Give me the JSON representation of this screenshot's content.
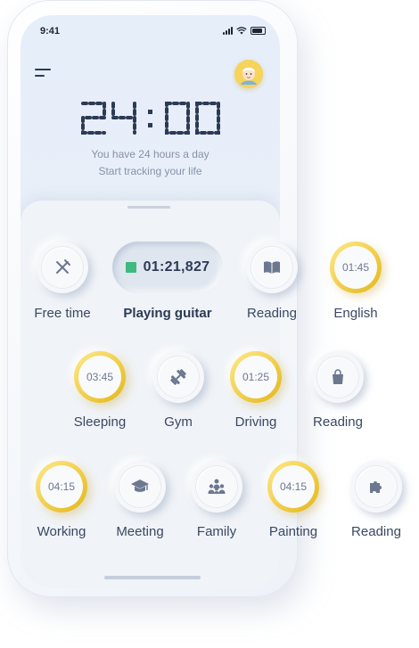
{
  "status": {
    "time": "9:41"
  },
  "clock": {
    "display": "24:00"
  },
  "header": {
    "line1": "You have 24 hours a day",
    "line2": "Start tracking your life"
  },
  "active": {
    "label": "Playing guitar",
    "timer": "01:21,827",
    "indicator_color": "#3fb97f"
  },
  "activities": {
    "free_time": {
      "label": "Free time",
      "icon": "fork-knife-icon"
    },
    "reading1": {
      "label": "Reading",
      "icon": "book-icon"
    },
    "english": {
      "label": "English",
      "timer": "01:45"
    },
    "sleeping": {
      "label": "Sleeping",
      "timer": "03:45"
    },
    "gym": {
      "label": "Gym",
      "icon": "dumbbell-icon"
    },
    "driving": {
      "label": "Driving",
      "timer": "01:25"
    },
    "reading2": {
      "label": "Reading",
      "icon": "shopping-bag-icon"
    },
    "working": {
      "label": "Working",
      "timer": "04:15"
    },
    "meeting": {
      "label": "Meeting",
      "icon": "graduation-cap-icon"
    },
    "family": {
      "label": "Family",
      "icon": "family-icon"
    },
    "painting": {
      "label": "Painting",
      "timer": "04:15"
    },
    "reading3": {
      "label": "Reading",
      "icon": "puzzle-icon"
    }
  },
  "colors": {
    "accent_gold": "#f0cd3a",
    "running_green": "#3fb97f",
    "text_dark": "#2c3a55"
  }
}
